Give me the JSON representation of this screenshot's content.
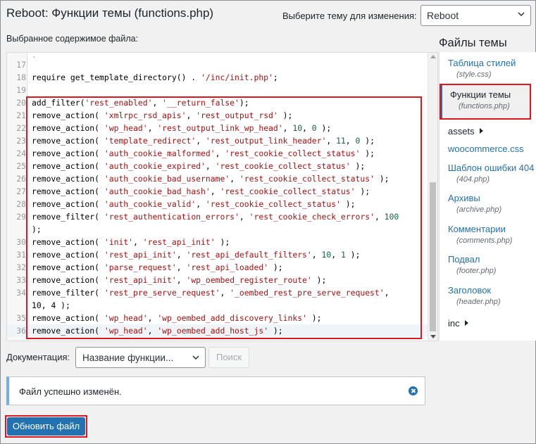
{
  "header": {
    "title": "Reboot: Функции темы (functions.php)",
    "theme_select_label": "Выберите тему для изменения:",
    "theme_selected": "Reboot"
  },
  "editor": {
    "content_label": "Выбранное содержимое файла:",
    "lines": [
      {
        "n": "17",
        "code": ""
      },
      {
        "n": "18",
        "code": "require get_template_directory() . '/inc/init.php';"
      },
      {
        "n": "19",
        "code": ""
      },
      {
        "n": "20",
        "code": "add_filter('rest_enabled', '__return_false');"
      },
      {
        "n": "21",
        "code": "remove_action( 'xmlrpc_rsd_apis', 'rest_output_rsd' );"
      },
      {
        "n": "22",
        "code": "remove_action( 'wp_head', 'rest_output_link_wp_head', 10, 0 );"
      },
      {
        "n": "23",
        "code": "remove_action( 'template_redirect', 'rest_output_link_header', 11, 0 );"
      },
      {
        "n": "24",
        "code": "remove_action( 'auth_cookie_malformed', 'rest_cookie_collect_status' );"
      },
      {
        "n": "25",
        "code": "remove_action( 'auth_cookie_expired', 'rest_cookie_collect_status' );"
      },
      {
        "n": "26",
        "code": "remove_action( 'auth_cookie_bad_username', 'rest_cookie_collect_status' );"
      },
      {
        "n": "27",
        "code": "remove_action( 'auth_cookie_bad_hash', 'rest_cookie_collect_status' );"
      },
      {
        "n": "28",
        "code": "remove_action( 'auth_cookie_valid', 'rest_cookie_collect_status' );"
      },
      {
        "n": "29",
        "code": "remove_filter( 'rest_authentication_errors', 'rest_cookie_check_errors', 100",
        "cont": ");"
      },
      {
        "n": "30",
        "code": "remove_action( 'init', 'rest_api_init' );"
      },
      {
        "n": "31",
        "code": "remove_action( 'rest_api_init', 'rest_api_default_filters', 10, 1 );"
      },
      {
        "n": "32",
        "code": "remove_action( 'parse_request', 'rest_api_loaded' );"
      },
      {
        "n": "33",
        "code": "remove_action( 'rest_api_init', 'wp_oembed_register_route' );"
      },
      {
        "n": "34",
        "code": "remove_filter( 'rest_pre_serve_request', '_oembed_rest_pre_serve_request',",
        "cont": "10, 4 );"
      },
      {
        "n": "35",
        "code": "remove_action( 'wp_head', 'wp_oembed_add_discovery_links' );"
      },
      {
        "n": "36",
        "code": "remove_action( 'wp_head', 'wp_oembed_add_host_js' );"
      }
    ]
  },
  "sidebar": {
    "title": "Файлы темы",
    "files": [
      {
        "name": "Таблица стилей",
        "sub": "(style.css)"
      },
      {
        "name": "Функции темы",
        "sub": "(functions.php)",
        "current": true
      },
      {
        "name": "assets",
        "folder": true
      },
      {
        "name": "woocommerce.css"
      },
      {
        "name": "Шаблон ошибки 404",
        "sub": "(404.php)"
      },
      {
        "name": "Архивы",
        "sub": "(archive.php)"
      },
      {
        "name": "Комментарии",
        "sub": "(comments.php)"
      },
      {
        "name": "Подвал",
        "sub": "(footer.php)"
      },
      {
        "name": "Заголовок",
        "sub": "(header.php)"
      },
      {
        "name": "inc",
        "folder": true
      }
    ]
  },
  "docs": {
    "label": "Документация:",
    "select_value": "Название функции...",
    "lookup_label": "Поиск"
  },
  "notice": {
    "text": "Файл успешно изменён."
  },
  "actions": {
    "save_label": "Обновить файл"
  },
  "colors": {
    "accent": "#2271b1",
    "highlight": "#e0161e",
    "notice_border": "#72aee6"
  }
}
